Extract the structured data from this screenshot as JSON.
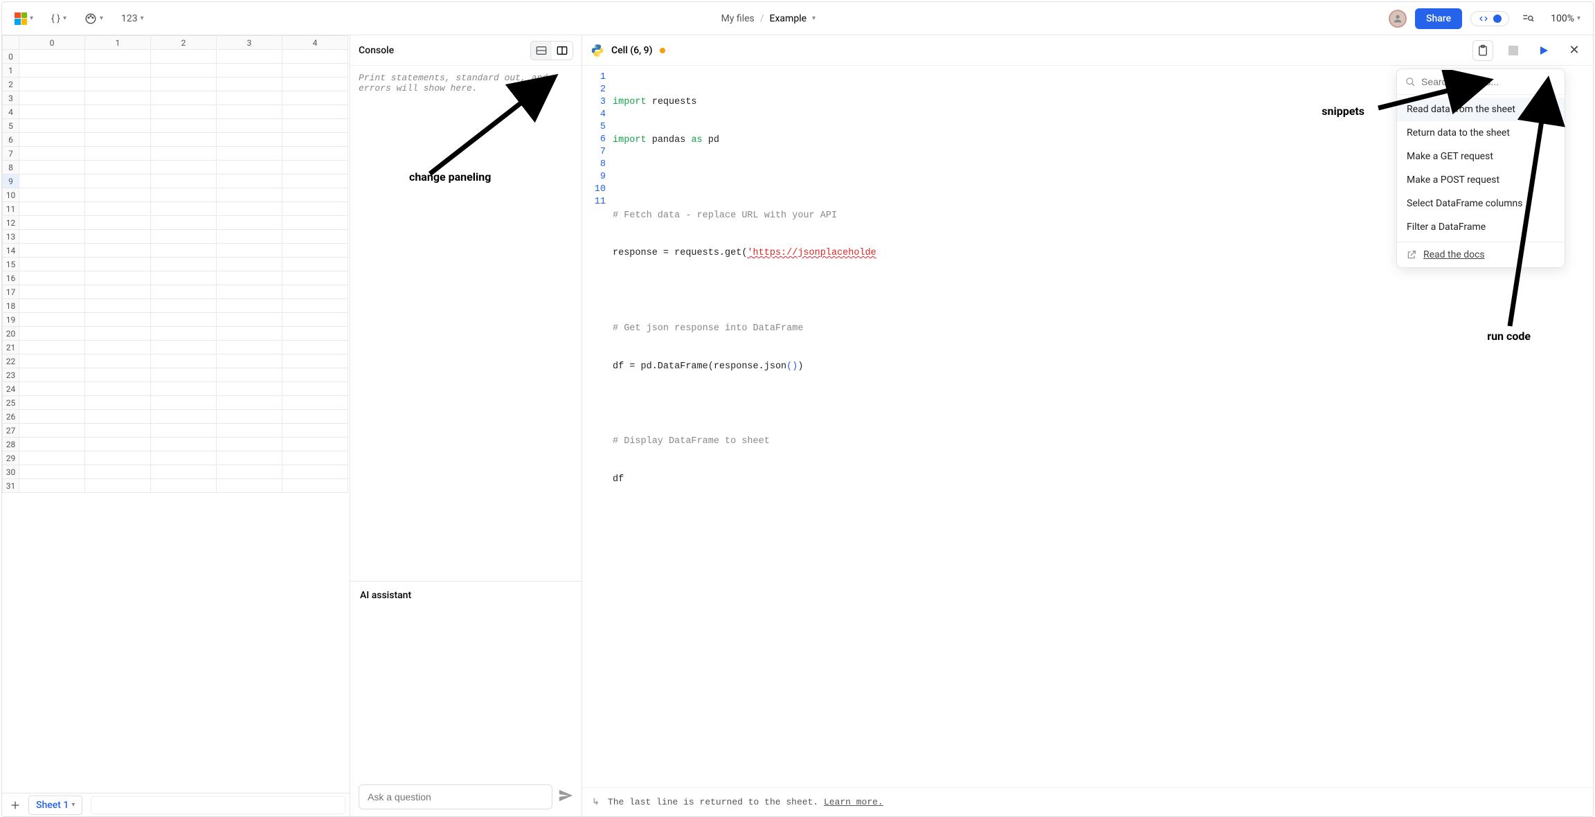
{
  "toolbar": {
    "format_number_label": "123"
  },
  "breadcrumb": {
    "root": "My files",
    "doc": "Example"
  },
  "share_label": "Share",
  "zoom": "100%",
  "sheet": {
    "columns": [
      "0",
      "1",
      "2",
      "3",
      "4"
    ],
    "rows": [
      "0",
      "1",
      "2",
      "3",
      "4",
      "5",
      "6",
      "7",
      "8",
      "9",
      "10",
      "11",
      "12",
      "13",
      "14",
      "15",
      "16",
      "17",
      "18",
      "19",
      "20",
      "21",
      "22",
      "23",
      "24",
      "25",
      "26",
      "27",
      "28",
      "29",
      "30",
      "31"
    ],
    "selected_row": "9",
    "tab_name": "Sheet 1"
  },
  "console": {
    "title": "Console",
    "placeholder": "Print statements, standard out, and errors will show here."
  },
  "ai": {
    "title": "AI assistant",
    "placeholder": "Ask a question"
  },
  "code": {
    "cell_label": "Cell (6, 9)",
    "lines": [
      {
        "n": "1"
      },
      {
        "n": "2"
      },
      {
        "n": "3"
      },
      {
        "n": "4"
      },
      {
        "n": "5"
      },
      {
        "n": "6"
      },
      {
        "n": "7"
      },
      {
        "n": "8"
      },
      {
        "n": "9"
      },
      {
        "n": "10"
      },
      {
        "n": "11"
      }
    ],
    "l1_kw": "import",
    "l1_mod": "requests",
    "l2_kw": "import",
    "l2_mod": "pandas",
    "l2_as": "as",
    "l2_alias": "pd",
    "l4_cmt": "# Fetch data - replace URL with your API",
    "l5_a": "response = requests.get(",
    "l5_q": "'",
    "l5_url": "https://jsonplaceholde",
    "l7_cmt": "# Get json response into DataFrame",
    "l8_a": "df = pd.DataFrame(response.json",
    "l8_p": "()",
    "l8_c": ")",
    "l10_cmt": "# Display DataFrame to sheet",
    "l11": "df",
    "footer_text": "The last line is returned to the sheet. ",
    "footer_link": "Learn more."
  },
  "snippets": {
    "search_placeholder": "Search snippets...",
    "items": [
      "Read data from the sheet",
      "Return data to the sheet",
      "Make a GET request",
      "Make a POST request",
      "Select DataFrame columns",
      "Filter a DataFrame"
    ],
    "docs_label": "Read the docs"
  },
  "annotations": {
    "paneling": "change paneling",
    "snippets": "snippets",
    "run": "run code"
  }
}
